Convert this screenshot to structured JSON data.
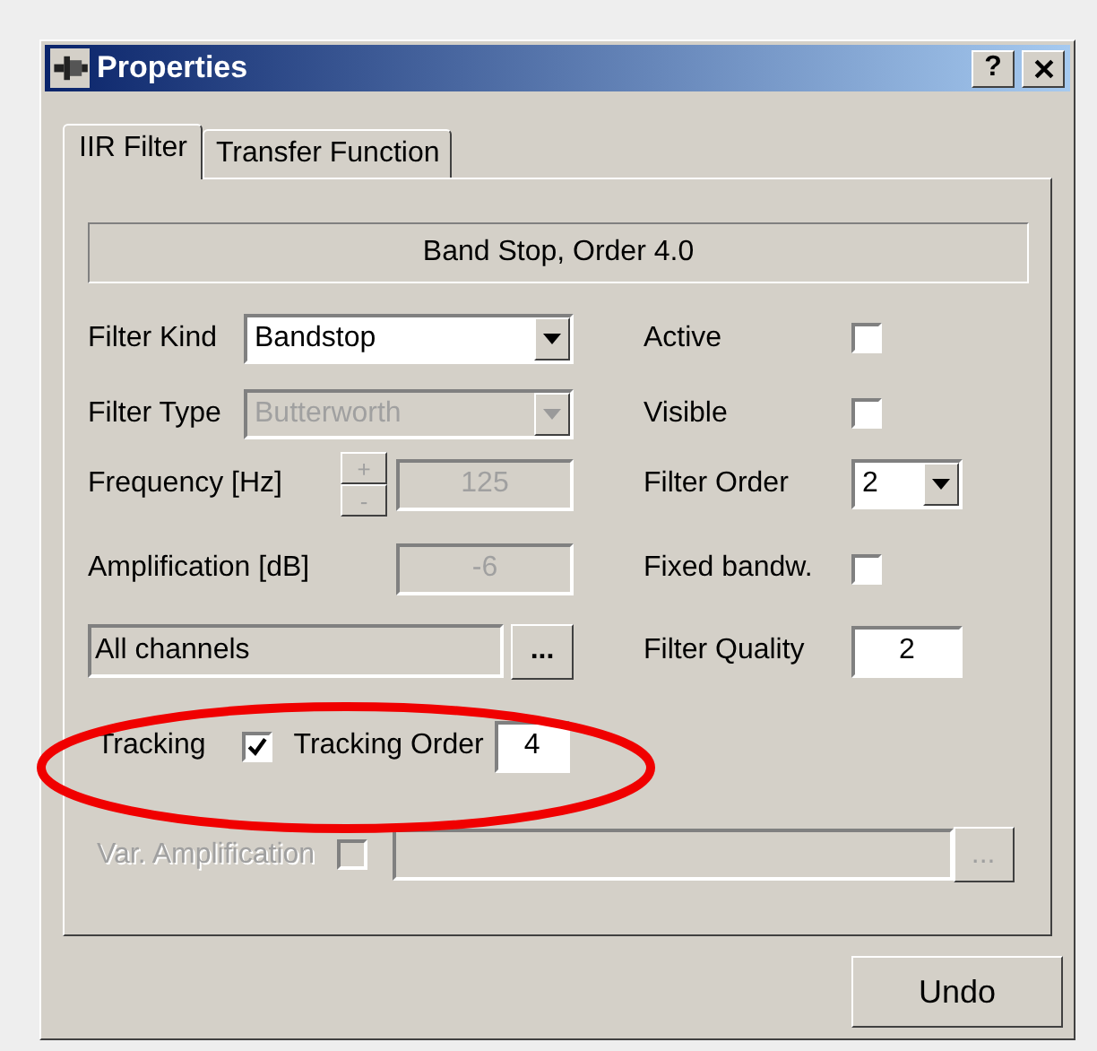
{
  "window": {
    "title": "Properties",
    "help_button": "?"
  },
  "tabs": [
    {
      "label": "IIR Filter",
      "selected": true
    },
    {
      "label": "Transfer Function",
      "selected": false
    }
  ],
  "summary": "Band Stop, Order 4.0",
  "left_rows": [
    {
      "kind": "dropdown",
      "label": "Filter Kind",
      "value": "Bandstop",
      "disabled": false
    },
    {
      "kind": "dropdown",
      "label": "Filter Type",
      "value": "Butterworth",
      "disabled": true
    },
    {
      "kind": "spin",
      "label": "Frequency [Hz]",
      "value": "125",
      "disabled": true,
      "up": "+",
      "down": "-"
    },
    {
      "kind": "text",
      "label": "Amplification [dB]",
      "value": "-6",
      "disabled": true
    },
    {
      "kind": "picker",
      "value": "All channels",
      "button": "...",
      "disabled": false
    }
  ],
  "right_rows": [
    {
      "kind": "checkbox",
      "label": "Active",
      "checked": false
    },
    {
      "kind": "checkbox",
      "label": "Visible",
      "checked": false
    },
    {
      "kind": "dropdown",
      "label": "Filter Order",
      "value": "2"
    },
    {
      "kind": "checkbox",
      "label": "Fixed bandw.",
      "checked": false
    },
    {
      "kind": "text",
      "label": "Filter Quality",
      "value": "2"
    }
  ],
  "tracking": {
    "label": "Tracking",
    "checked": true,
    "order_label": "Tracking Order",
    "order_value": "4",
    "highlighted": true
  },
  "var_amplification": {
    "label": "Var. Amplification",
    "checked": false,
    "disabled": true,
    "button": "..."
  },
  "buttons": [
    {
      "label": "Undo"
    }
  ]
}
